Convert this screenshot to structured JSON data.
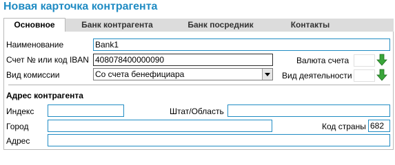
{
  "window": {
    "title": "Новая карточка контрагента"
  },
  "tabs": [
    {
      "label": "Основное",
      "active": true
    },
    {
      "label": "Банк контрагента",
      "active": false
    },
    {
      "label": "Банк посредник",
      "active": false
    },
    {
      "label": "Контакты",
      "active": false
    }
  ],
  "form": {
    "name_label": "Наименование",
    "name_value": "Bank1",
    "account_label": "Счет № или код IBAN",
    "account_value": "408078400000090",
    "currency_label": "Валюта счета",
    "currency_value": "",
    "commission_label": "Вид комиссии",
    "commission_value": "Со счета бенефициара",
    "activity_label": "Вид деятельности",
    "activity_value": ""
  },
  "address": {
    "section_title": "Адрес контрагента",
    "index_label": "Индекс",
    "index_value": "",
    "state_label": "Штат/Область",
    "state_value": "",
    "city_label": "Город",
    "city_value": "",
    "country_code_label": "Код страны",
    "country_code_value": "682",
    "address_label": "Адрес",
    "address_value": ""
  },
  "icons": {
    "currency_picker": "green-down-arrow-icon",
    "activity_picker": "green-down-arrow-icon"
  },
  "colors": {
    "accent": "#1f8bc3",
    "picker_green": "#3aa63a"
  }
}
